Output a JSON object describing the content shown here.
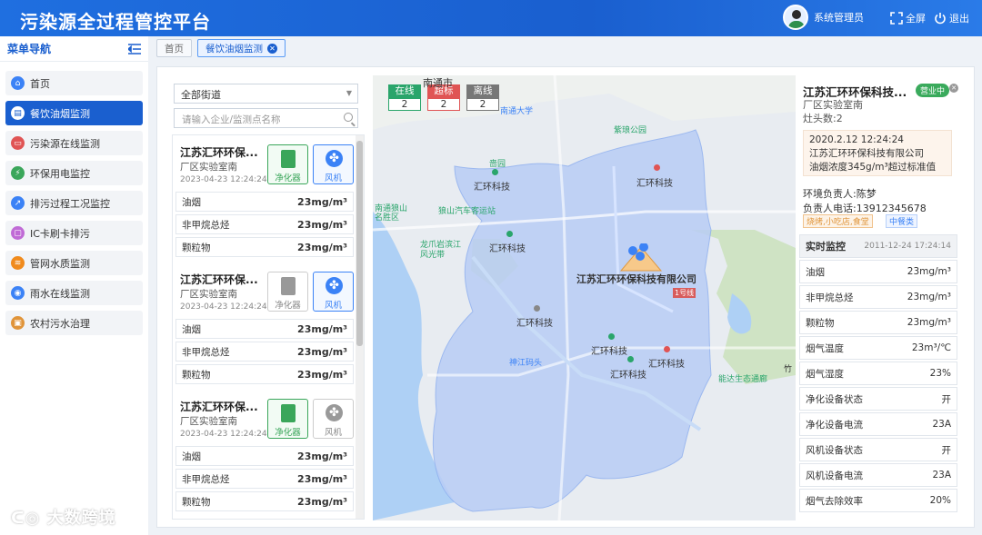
{
  "app": {
    "title": "污染源全过程管控平台",
    "user": "系统管理员",
    "fullscreen": "全屏",
    "logout": "退出"
  },
  "sidebar": {
    "header": "菜单导航",
    "items": [
      {
        "label": "首页",
        "icon": "home-icon",
        "color": "#3b82f6"
      },
      {
        "label": "餐饮油烟监测",
        "icon": "restaurant-icon",
        "color": "#1a5fcf",
        "active": true
      },
      {
        "label": "污染源在线监测",
        "icon": "monitor-icon",
        "color": "#e05454"
      },
      {
        "label": "环保用电监控",
        "icon": "power-icon",
        "color": "#3aa65a"
      },
      {
        "label": "排污过程工况监控",
        "icon": "chart-icon",
        "color": "#3b82f6"
      },
      {
        "label": "IC卡刷卡排污",
        "icon": "card-icon",
        "color": "#c06bd6"
      },
      {
        "label": "管网水质监测",
        "icon": "pipe-icon",
        "color": "#f08a1c"
      },
      {
        "label": "雨水在线监测",
        "icon": "rain-icon",
        "color": "#3b82f6"
      },
      {
        "label": "农村污水治理",
        "icon": "village-icon",
        "color": "#e0943a"
      }
    ]
  },
  "tabs": [
    "首页",
    "餐饮油烟监测"
  ],
  "filter": {
    "street": "全部街道",
    "placeholder": "请输入企业/监测点名称"
  },
  "cards": [
    {
      "name": "江苏汇环环保...",
      "loc": "厂区实验室南",
      "time": "2023-04-23 12:24:24",
      "purifier": "净化器",
      "fan": "风机",
      "purifier_on": true,
      "fan_on": true,
      "rows": [
        {
          "k": "油烟",
          "v": "23mg/m³"
        },
        {
          "k": "非甲烷总烃",
          "v": "23mg/m³"
        },
        {
          "k": "颗粒物",
          "v": "23mg/m³"
        }
      ]
    },
    {
      "name": "江苏汇环环保...",
      "loc": "厂区实验室南",
      "time": "2023-04-23 12:24:24",
      "purifier": "净化器",
      "fan": "风机",
      "purifier_on": false,
      "fan_on": true,
      "rows": [
        {
          "k": "油烟",
          "v": "23mg/m³"
        },
        {
          "k": "非甲烷总烃",
          "v": "23mg/m³"
        },
        {
          "k": "颗粒物",
          "v": "23mg/m³"
        }
      ]
    },
    {
      "name": "江苏汇环环保...",
      "loc": "厂区实验室南",
      "time": "2023-04-23 12:24:24",
      "purifier": "净化器",
      "fan": "风机",
      "purifier_on": true,
      "fan_on": false,
      "rows": [
        {
          "k": "油烟",
          "v": "23mg/m³"
        },
        {
          "k": "非甲烷总烃",
          "v": "23mg/m³"
        },
        {
          "k": "颗粒物",
          "v": "23mg/m³"
        }
      ]
    }
  ],
  "map": {
    "legend": [
      {
        "label": "在线",
        "value": "2",
        "color": "#2aa56b"
      },
      {
        "label": "超标",
        "value": "2",
        "color": "#e05454"
      },
      {
        "label": "离线",
        "value": "2",
        "color": "#777777"
      }
    ],
    "labels": [
      "南通市",
      "南通大学",
      "紫琅公园",
      "啬园",
      "狼山汽车客运站",
      "汇环科技",
      "汇环科技",
      "汇环科技",
      "江苏汇环环保科技有限公司",
      "汇环科技",
      "汇环科技",
      "汇环科技",
      "汇环科技",
      "神江码头",
      "龙爪岩滨江风光带",
      "能达生态通廊",
      "南通狼山名胜区",
      "1号线",
      "竹"
    ]
  },
  "detail": {
    "name": "江苏汇环环保科技...",
    "status": "营业中",
    "loc": "厂区实验室南",
    "stoves": "灶头数:2",
    "alert_time": "2020.2.12  12:24:24",
    "alert_company": "江苏汇环环保科技有限公司",
    "alert_msg": "油烟浓度345g/m³超过标准值",
    "person": "环境负责人:陈梦",
    "phone": "负责人电话:13912345678",
    "tags": [
      "烧烤,小吃店,食堂",
      "中餐类"
    ],
    "rt_title": "实时监控",
    "rt_time": "2011-12-24  17:24:14",
    "rows": [
      {
        "k": "油烟",
        "v": "23mg/m³"
      },
      {
        "k": "非甲烷总烃",
        "v": "23mg/m³"
      },
      {
        "k": "颗粒物",
        "v": "23mg/m³"
      },
      {
        "k": "烟气温度",
        "v": "23m³/℃"
      },
      {
        "k": "烟气湿度",
        "v": "23%"
      },
      {
        "k": "净化设备状态",
        "v": "开"
      },
      {
        "k": "净化设备电流",
        "v": "23A"
      },
      {
        "k": "风机设备状态",
        "v": "开"
      },
      {
        "k": "风机设备电流",
        "v": "23A"
      },
      {
        "k": "烟气去除效率",
        "v": "20%"
      }
    ]
  },
  "watermark": "大数跨境"
}
